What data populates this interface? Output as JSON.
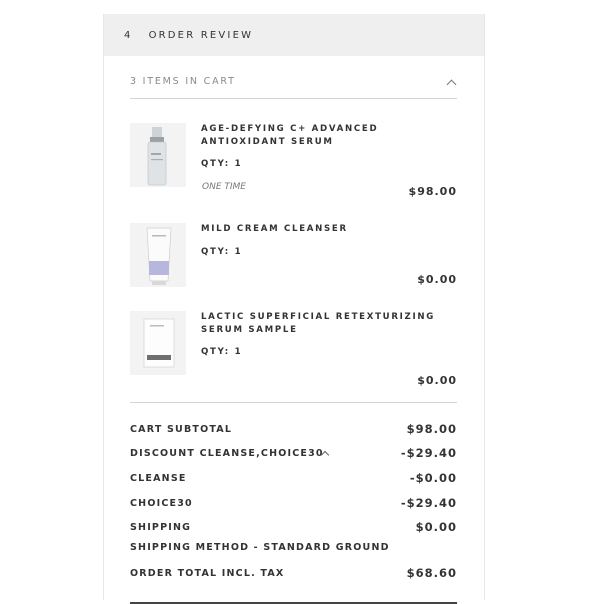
{
  "header": {
    "step": "4",
    "title": "ORDER REVIEW"
  },
  "cart": {
    "count_label": "3 ITEMS IN CART",
    "items": [
      {
        "name": "AGE-DEFYING C+ ADVANCED ANTIOXIDANT SERUM",
        "qty": "QTY:  1",
        "frequency": "ONE TIME",
        "price": "$98.00",
        "image": "serum-bottle-icon"
      },
      {
        "name": "MILD CREAM CLEANSER",
        "qty": "QTY:  1",
        "frequency": "",
        "price": "$0.00",
        "image": "cleanser-tube-icon"
      },
      {
        "name": "LACTIC SUPERFICIAL RETEXTURIZING SERUM SAMPLE",
        "qty": "QTY:  1",
        "frequency": "",
        "price": "$0.00",
        "image": "sample-packet-icon"
      }
    ]
  },
  "summary": {
    "subtotal_label": "CART SUBTOTAL",
    "subtotal_value": "$98.00",
    "discount_label": "DISCOUNT CLEANSE,CHOICE30",
    "discount_value": "-$29.40",
    "cleanse_label": "CLEANSE",
    "cleanse_value": "-$0.00",
    "choice30_label": "CHOICE30",
    "choice30_value": "-$29.40",
    "shipping_label": "SHIPPING",
    "shipping_value": "$0.00",
    "shipping_method": "SHIPPING METHOD - STANDARD GROUND",
    "total_label": "ORDER TOTAL INCL. TAX",
    "total_value": "$68.60"
  }
}
